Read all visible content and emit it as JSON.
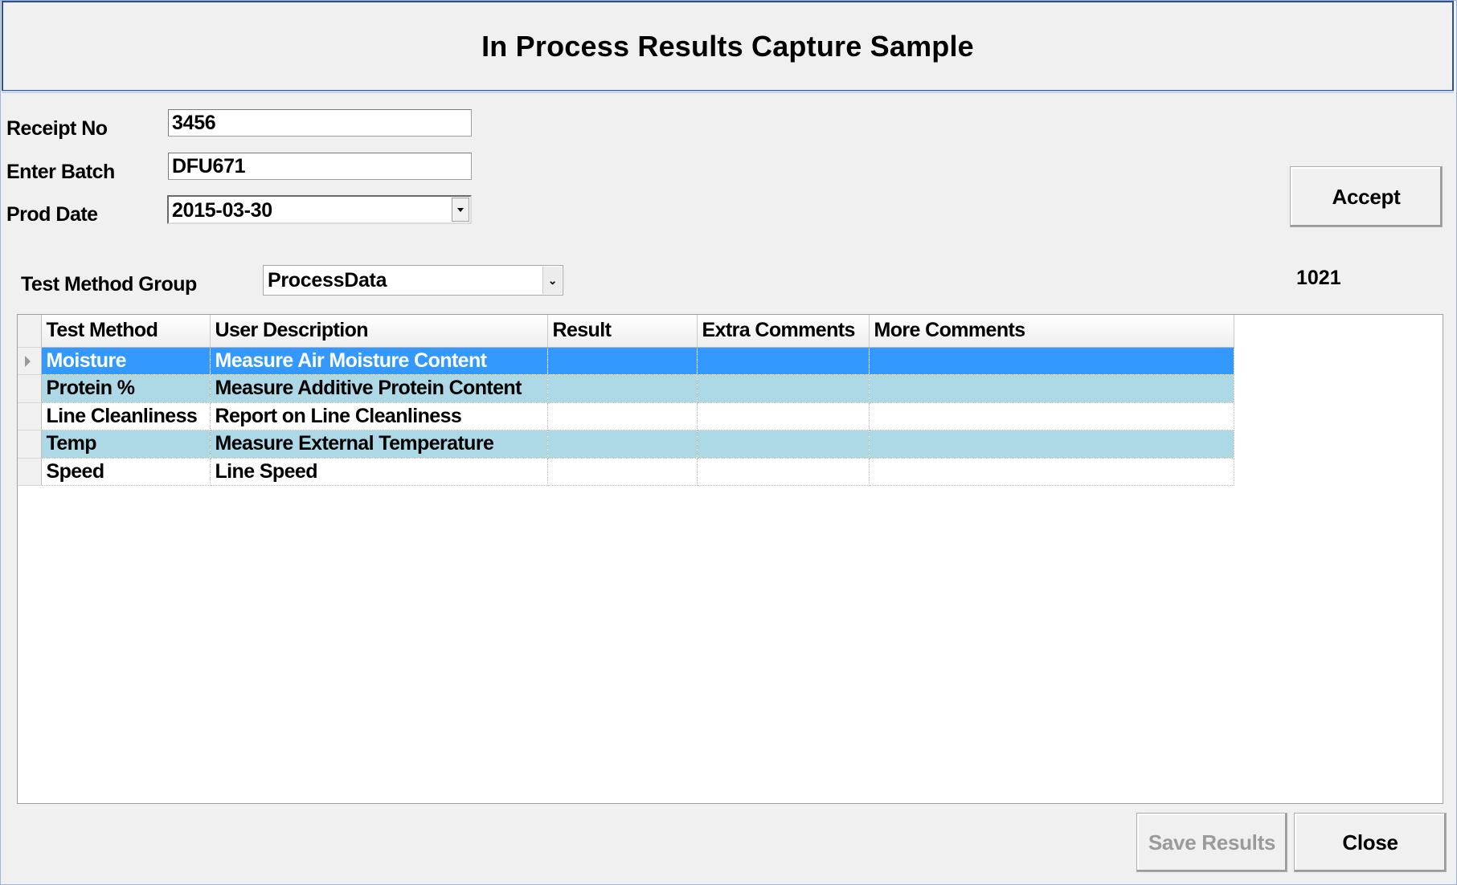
{
  "window": {
    "title": "In Process Results Capture Sample"
  },
  "form": {
    "receipt_label": "Receipt No",
    "receipt_value": "3456",
    "batch_label": "Enter Batch",
    "batch_value": "DFU671",
    "prod_date_label": "Prod Date",
    "prod_date_value": "2015-03-30",
    "test_group_label": "Test Method Group",
    "test_group_value": "ProcessData",
    "counter": "1021"
  },
  "buttons": {
    "accept": "Accept",
    "save": "Save Results",
    "close": "Close"
  },
  "grid": {
    "columns": [
      "Test Method",
      "User Description",
      "Result",
      "Extra Comments",
      "More Comments"
    ],
    "rows": [
      [
        "Moisture",
        "Measure Air Moisture Content",
        "",
        "",
        ""
      ],
      [
        "Protein %",
        "Measure Additive Protein Content",
        "",
        "",
        ""
      ],
      [
        "Line Cleanliness",
        "Report on Line Cleanliness",
        "",
        "",
        ""
      ],
      [
        "Temp",
        "Measure External Temperature",
        "",
        "",
        ""
      ],
      [
        "Speed",
        "Line Speed",
        "",
        "",
        ""
      ]
    ],
    "selected_row": 0
  },
  "colors": {
    "selection": "#3399ff",
    "alt_row": "#add8e6",
    "title_border": "#2d4f96"
  },
  "icons": {
    "dropdown": "chevron-down-icon",
    "row_pointer": "row-pointer-icon"
  }
}
